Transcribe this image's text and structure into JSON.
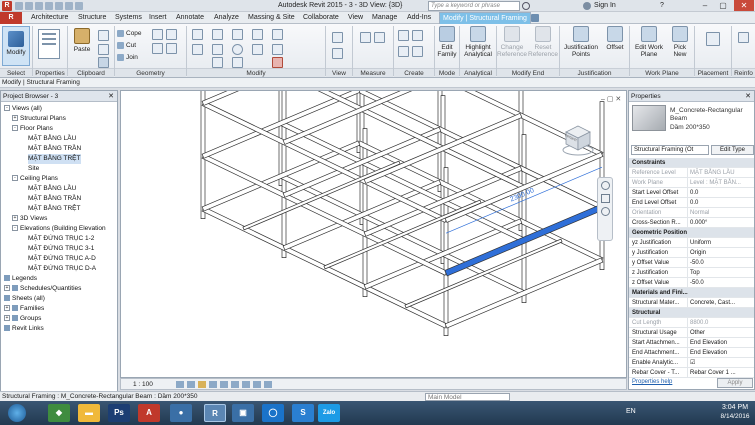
{
  "titlebar": {
    "title": "Autodesk Revit 2015  -  3 - 3D View: {3D}",
    "search_placeholder": "Type a keyword or phrase",
    "sign_in": "Sign In",
    "help": "?"
  },
  "tabs": {
    "r": "R",
    "items": [
      "Architecture",
      "Structure",
      "Systems",
      "Insert",
      "Annotate",
      "Analyze",
      "Massing & Site",
      "Collaborate",
      "View",
      "Manage",
      "Add-Ins"
    ],
    "context_tab": "Modify | Structural Framing"
  },
  "ribbon": {
    "modify": "Modify",
    "paste": "Paste",
    "cope": "Cope",
    "cut": "Cut",
    "join": "Join",
    "edit_family": "Edit Family",
    "highlight_analytical": "Highlight Analytical",
    "change_reference": "Change Reference",
    "reset_reference": "Reset Reference",
    "justification_points": "Justification Points",
    "offset": "Offset",
    "edit_work_plane": "Edit Work Plane",
    "pick_new": "Pick New",
    "panels": {
      "select": "Select",
      "properties": "Properties",
      "clipboard": "Clipboard",
      "geometry": "Geometry",
      "modify": "Modify",
      "view": "View",
      "measure": "Measure",
      "create": "Create",
      "mode": "Mode",
      "analytical": "Analytical",
      "modify_end": "Modify End",
      "justification": "Justification",
      "work_plane": "Work Plane",
      "placement": "Placement",
      "reinfo": "Reinfo"
    }
  },
  "context_bar": "Modify | Structural Framing",
  "project_browser": {
    "title": "Project Browser - 3",
    "items": [
      {
        "label": "Views (all)",
        "indent": 0,
        "exp": "-"
      },
      {
        "label": "Structural Plans",
        "indent": 1,
        "exp": "+"
      },
      {
        "label": "Floor Plans",
        "indent": 1,
        "exp": "-"
      },
      {
        "label": "MẶT BẰNG LẦU",
        "indent": 3,
        "exp": ""
      },
      {
        "label": "MẶT BẰNG TRẦN",
        "indent": 3,
        "exp": ""
      },
      {
        "label": "MẶT BẰNG TRỆT",
        "indent": 3,
        "exp": "",
        "hl": true
      },
      {
        "label": "Site",
        "indent": 3,
        "exp": ""
      },
      {
        "label": "Ceiling Plans",
        "indent": 1,
        "exp": "-"
      },
      {
        "label": "MẶT BẰNG LẦU",
        "indent": 3,
        "exp": ""
      },
      {
        "label": "MẶT BẰNG TRẦN",
        "indent": 3,
        "exp": ""
      },
      {
        "label": "MẶT BẰNG TRỆT",
        "indent": 3,
        "exp": ""
      },
      {
        "label": "3D Views",
        "indent": 1,
        "exp": "+"
      },
      {
        "label": "Elevations (Building Elevation",
        "indent": 1,
        "exp": "-"
      },
      {
        "label": "MẶT ĐỨNG TRỤC 1-2",
        "indent": 3,
        "exp": ""
      },
      {
        "label": "MẶT ĐỨNG TRỤC 3-1",
        "indent": 3,
        "exp": ""
      },
      {
        "label": "MẶT ĐỨNG TRỤC A-D",
        "indent": 3,
        "exp": ""
      },
      {
        "label": "MẶT ĐỨNG TRỤC D-A",
        "indent": 3,
        "exp": ""
      },
      {
        "label": "Legends",
        "indent": 0,
        "exp": "",
        "icon": true
      },
      {
        "label": "Schedules/Quantities",
        "indent": 0,
        "exp": "+",
        "icon": true
      },
      {
        "label": "Sheets (all)",
        "indent": 0,
        "exp": "",
        "icon": true
      },
      {
        "label": "Families",
        "indent": 0,
        "exp": "+",
        "icon": true
      },
      {
        "label": "Groups",
        "indent": 0,
        "exp": "+",
        "icon": true
      },
      {
        "label": "Revit Links",
        "indent": 0,
        "exp": "",
        "icon": true
      }
    ]
  },
  "viewport": {
    "dimension": "2300.00",
    "viewcube_front": "FRONT",
    "scale": "1 : 100"
  },
  "properties": {
    "title": "Properties",
    "type_name": "M_Concrete-Rectangular Beam",
    "type_sub": "Dầm 200*350",
    "selector": "Structural Framing (Ot",
    "edit_type": "Edit Type",
    "rows": [
      {
        "k": "Constraints",
        "grp": true
      },
      {
        "k": "Reference Level",
        "v": "MẶT BẰNG LẦU",
        "dim": true
      },
      {
        "k": "Work Plane",
        "v": "Level : MẶT BẰN...",
        "dim": true
      },
      {
        "k": "Start Level Offset",
        "v": "0.0"
      },
      {
        "k": "End Level Offset",
        "v": "0.0"
      },
      {
        "k": "Orientation",
        "v": "Normal",
        "dim": true
      },
      {
        "k": "Cross-Section R...",
        "v": "0.000°"
      },
      {
        "k": "Geometric Position",
        "grp": true
      },
      {
        "k": "yz Justification",
        "v": "Uniform"
      },
      {
        "k": "y Justification",
        "v": "Origin"
      },
      {
        "k": "y Offset Value",
        "v": "-50.0"
      },
      {
        "k": "z Justification",
        "v": "Top"
      },
      {
        "k": "z Offset Value",
        "v": "-50.0"
      },
      {
        "k": "Materials and Fini...",
        "grp": true
      },
      {
        "k": "Structural Mater...",
        "v": "Concrete, Cast..."
      },
      {
        "k": "Structural",
        "grp": true
      },
      {
        "k": "Cut Length",
        "v": "8800.0",
        "dim": true
      },
      {
        "k": "Structural Usage",
        "v": "Other"
      },
      {
        "k": "Start Attachmen...",
        "v": "End Elevation"
      },
      {
        "k": "End Attachment...",
        "v": "End Elevation"
      },
      {
        "k": "Enable Analytic...",
        "v": "☑"
      },
      {
        "k": "Rebar Cover - T...",
        "v": "Rebar Cover 1 ..."
      }
    ],
    "help_link": "Properties help",
    "apply": "Apply"
  },
  "status": {
    "text": "Structural Framing : M_Concrete-Rectangular Beam : Dầm 200*350",
    "model": "Main Model"
  },
  "taskbar": {
    "lang": "EN",
    "time": "3:04 PM",
    "date": "8/14/2016"
  },
  "colors": {
    "selected_beam": "#2f6fd8",
    "frame_fill": "#ffffff",
    "frame_stroke": "#333333"
  }
}
